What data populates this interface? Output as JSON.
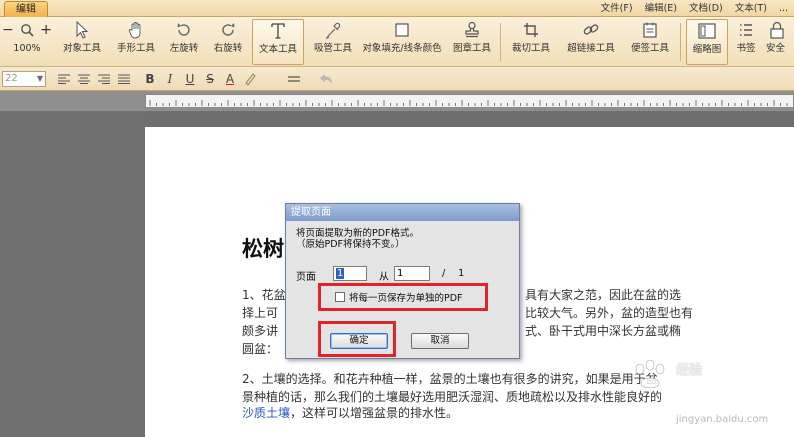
{
  "titlebar": {
    "active_tab": "编辑",
    "menus": [
      "文件(F)",
      "编辑(E)",
      "文档(D)",
      "文本(T)",
      "..."
    ]
  },
  "toolbar": {
    "zoom_value": "100%",
    "tools": [
      {
        "label": "对象工具",
        "icon": "cursor-icon"
      },
      {
        "label": "手形工具",
        "icon": "hand-icon"
      },
      {
        "label": "左旋转",
        "icon": "rotate-left-icon"
      },
      {
        "label": "右旋转",
        "icon": "rotate-right-icon"
      },
      {
        "label": "文本工具",
        "icon": "text-tool-icon"
      },
      {
        "label": "吸管工具",
        "icon": "eyedropper-icon"
      },
      {
        "label": "对象填充/线条颜色",
        "icon": "fill-color-icon"
      },
      {
        "label": "图章工具",
        "icon": "stamp-icon"
      },
      {
        "label": "裁切工具",
        "icon": "crop-icon"
      },
      {
        "label": "超链接工具",
        "icon": "link-icon"
      },
      {
        "label": "便签工具",
        "icon": "note-icon"
      },
      {
        "label": "缩略图",
        "icon": "thumbnail-icon"
      },
      {
        "label": "书签",
        "icon": "bookmark-icon"
      },
      {
        "label": "安全",
        "icon": "security-icon"
      }
    ]
  },
  "format_bar": {
    "font_size": "22",
    "buttons": [
      "B",
      "I",
      "U",
      "S",
      "A"
    ]
  },
  "document": {
    "title": "松树",
    "para1": [
      "1、花盆",
      "择上可",
      "颇多讲",
      "圆盆："
    ],
    "para1_right": [
      "具有大家之范，因此在盆的选",
      "比较大气。另外，盆的造型也有",
      "式、卧干式用中深长方盆或椭"
    ],
    "para2_line1": "2、土壤的选择。和花卉种植一样，盆景的土壤也有很多的讲究，如果是用于盆",
    "para2_line2": "景种植的话，那么我们的土壤最好选用肥沃湿润、质地疏松以及排水性能良好的",
    "para2_link": "沙质土壤",
    "para2_line3_rest": "，这样可以增强盆景的排水性。"
  },
  "dialog": {
    "title": "提取页面",
    "message_line1": "将页面提取为新的PDF格式。",
    "message_line2": "（原始PDF将保持不变。）",
    "page_label": "页面",
    "page_from_value": "1",
    "from_label": "从",
    "page_to_value": "1",
    "slash": "/",
    "total_pages": "1",
    "checkbox_label": "将每一页保存为单独的PDF",
    "checkbox_checked": false,
    "ok_button": "确定",
    "cancel_button": "取消"
  },
  "watermark": {
    "text": "经验",
    "url": "jingyan.baidu.com"
  },
  "colors": {
    "toolbar_bg": "#f2dfb8",
    "highlight": "#e0242c",
    "dialog_title": "#7f9ccc",
    "link": "#2a56c6"
  }
}
